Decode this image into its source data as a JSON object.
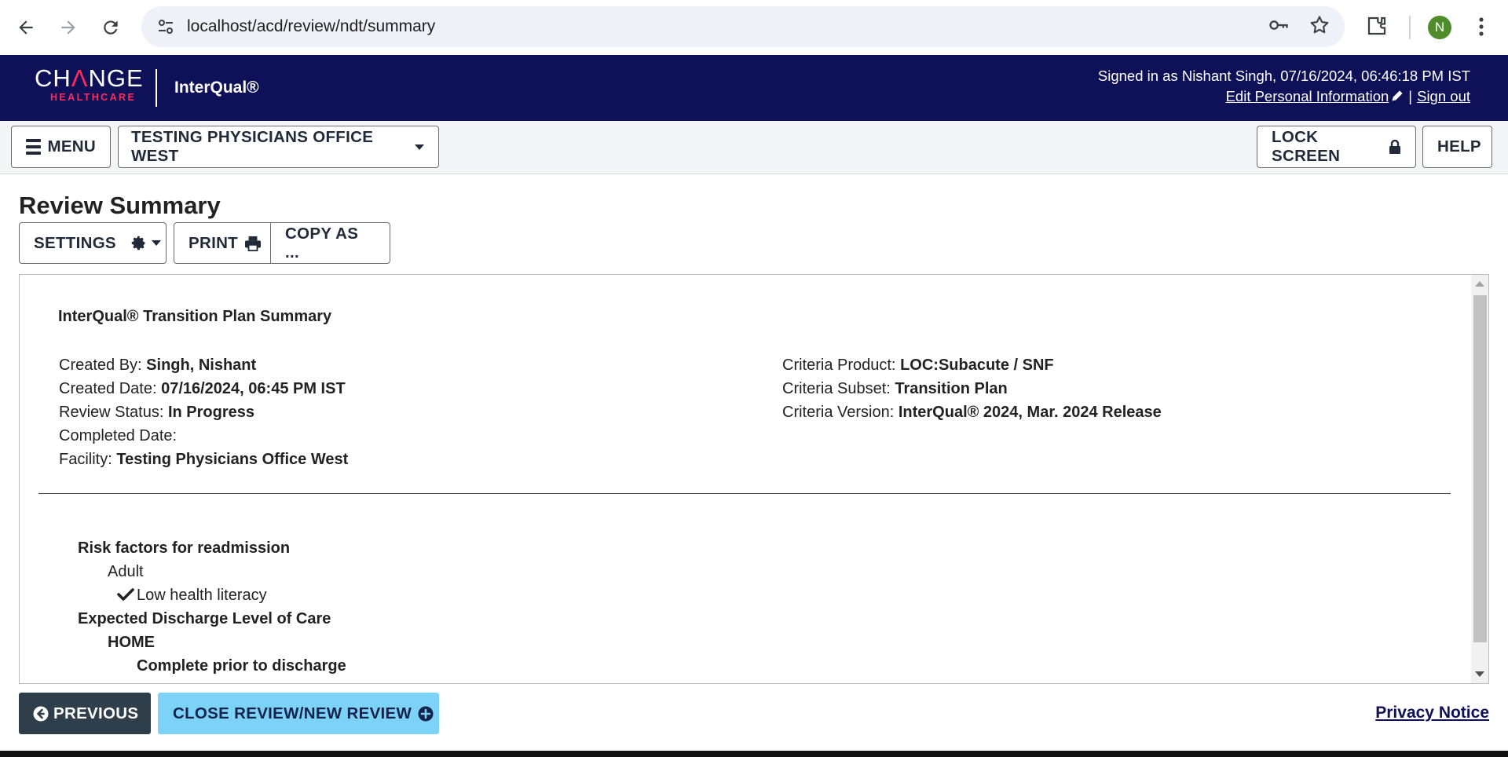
{
  "browser": {
    "url": "localhost/acd/review/ndt/summary",
    "profile_initial": "N"
  },
  "header": {
    "brand_top_1": "CH",
    "brand_top_a": "Λ",
    "brand_top_2": "NGE",
    "brand_bottom": "HEALTHCARE",
    "product": "InterQual®",
    "signed_in": "Signed in as Nishant Singh, 07/16/2024, 06:46:18 PM IST",
    "edit_info": "Edit Personal Information",
    "pipe": "|",
    "sign_out": "Sign out"
  },
  "toolbar": {
    "menu_label": "MENU",
    "facility_label": "TESTING PHYSICIANS OFFICE WEST",
    "lock_label": "LOCK SCREEN",
    "help_label": "HELP"
  },
  "page": {
    "title": "Review Summary",
    "settings_label": "SETTINGS",
    "print_label": "PRINT",
    "copy_label": "COPY AS ..."
  },
  "summary": {
    "doc_title": "InterQual® Transition Plan Summary",
    "left_meta": [
      {
        "label": "Created By: ",
        "value": "Singh, Nishant"
      },
      {
        "label": "Created Date: ",
        "value": "07/16/2024, 06:45 PM IST"
      },
      {
        "label": "Review Status: ",
        "value": "In Progress"
      },
      {
        "label": "Completed Date:",
        "value": ""
      },
      {
        "label": "Facility: ",
        "value": "Testing Physicians Office West"
      }
    ],
    "right_meta": [
      {
        "label": "Criteria Product: ",
        "value": "LOC:Subacute / SNF"
      },
      {
        "label": "Criteria Subset: ",
        "value": "Transition Plan"
      },
      {
        "label": "Criteria Version: ",
        "value": "InterQual® 2024, Mar. 2024 Release"
      }
    ],
    "tree": {
      "risk_heading": "Risk factors for readmission",
      "risk_group": "Adult",
      "risk_item": "Low health literacy",
      "discharge_heading": "Expected Discharge Level of Care",
      "discharge_value": "HOME",
      "discharge_sub": "Complete prior to discharge"
    }
  },
  "footer": {
    "previous_label": "PREVIOUS",
    "close_label": "CLOSE REVIEW/NEW REVIEW",
    "privacy_label": "Privacy Notice"
  },
  "colors": {
    "header_bg": "#0e1158",
    "brand_accent": "#ff2c5a",
    "previous_bg": "#2e3e4a",
    "close_bg": "#7dd3f7"
  }
}
